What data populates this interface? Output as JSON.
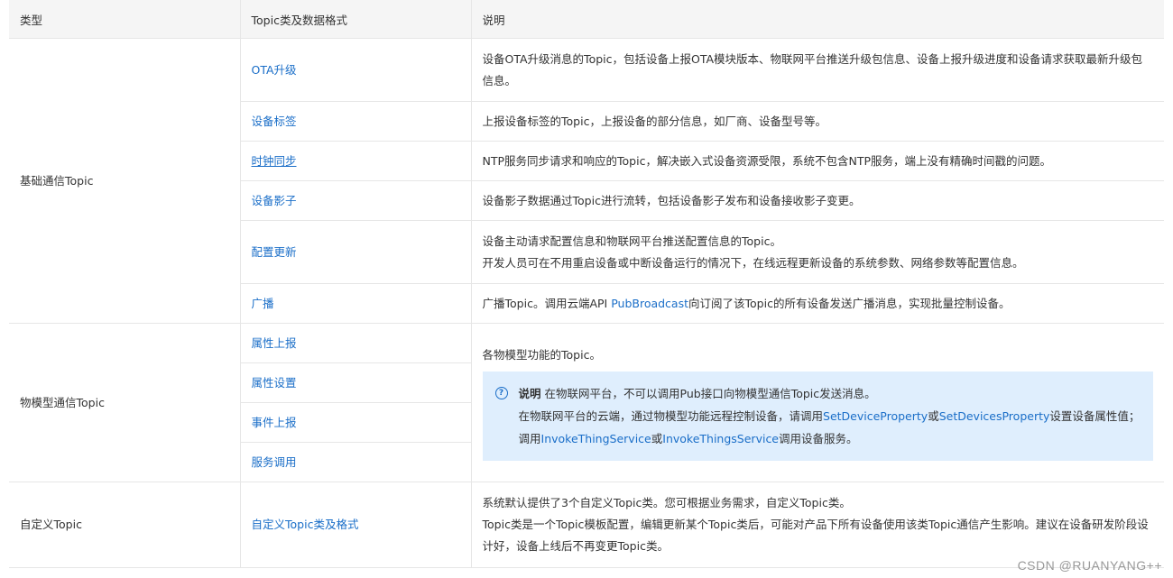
{
  "headers": {
    "type": "类型",
    "topic": "Topic类及数据格式",
    "desc": "说明"
  },
  "groups": {
    "basic": {
      "label": "基础通信Topic",
      "rows": [
        {
          "topic": "OTA升级",
          "desc": "设备OTA升级消息的Topic，包括设备上报OTA模块版本、物联网平台推送升级包信息、设备上报升级进度和设备请求获取最新升级包信息。"
        },
        {
          "topic": "设备标签",
          "desc": "上报设备标签的Topic，上报设备的部分信息，如厂商、设备型号等。"
        },
        {
          "topic": "时钟同步",
          "desc": "NTP服务同步请求和响应的Topic，解决嵌入式设备资源受限，系统不包含NTP服务，端上没有精确时间戳的问题。"
        },
        {
          "topic": "设备影子",
          "desc": "设备影子数据通过Topic进行流转，包括设备影子发布和设备接收影子变更。"
        },
        {
          "topic": "配置更新",
          "desc_line1": "设备主动请求配置信息和物联网平台推送配置信息的Topic。",
          "desc_line2": "开发人员可在不用重启设备或中断设备运行的情况下，在线远程更新设备的系统参数、网络参数等配置信息。"
        },
        {
          "topic": "广播",
          "desc_before": "广播Topic。调用云端API ",
          "desc_link": "PubBroadcast",
          "desc_after": "向订阅了该Topic的所有设备发送广播消息，实现批量控制设备。"
        }
      ]
    },
    "thing": {
      "label": "物模型通信Topic",
      "topics": [
        "属性上报",
        "属性设置",
        "事件上报",
        "服务调用"
      ],
      "desc": "各物模型功能的Topic。",
      "note": {
        "icon": "?",
        "title": "说明",
        "line1": "在物联网平台，不可以调用Pub接口向物模型通信Topic发送消息。",
        "line2_a": "在物联网平台的云端，通过物模型功能远程控制设备，请调用",
        "line2_link1": "SetDeviceProperty",
        "line2_b": "或",
        "line2_link2": "SetDevicesProperty",
        "line2_c": "设置设备属性值；",
        "line3_a": "调用",
        "line3_link1": "InvokeThingService",
        "line3_b": "或",
        "line3_link2": "InvokeThingsService",
        "line3_c": "调用设备服务。"
      }
    },
    "custom": {
      "label": "自定义Topic",
      "topic": "自定义Topic类及格式",
      "line1": "系统默认提供了3个自定义Topic类。您可根据业务需求，自定义Topic类。",
      "line2": "Topic类是一个Topic模板配置，编辑更新某个Topic类后，可能对产品下所有设备使用该类Topic通信产生影响。建议在设备研发阶段设计好，设备上线后不再变更Topic类。"
    }
  },
  "watermark": "CSDN @RUANYANG++"
}
